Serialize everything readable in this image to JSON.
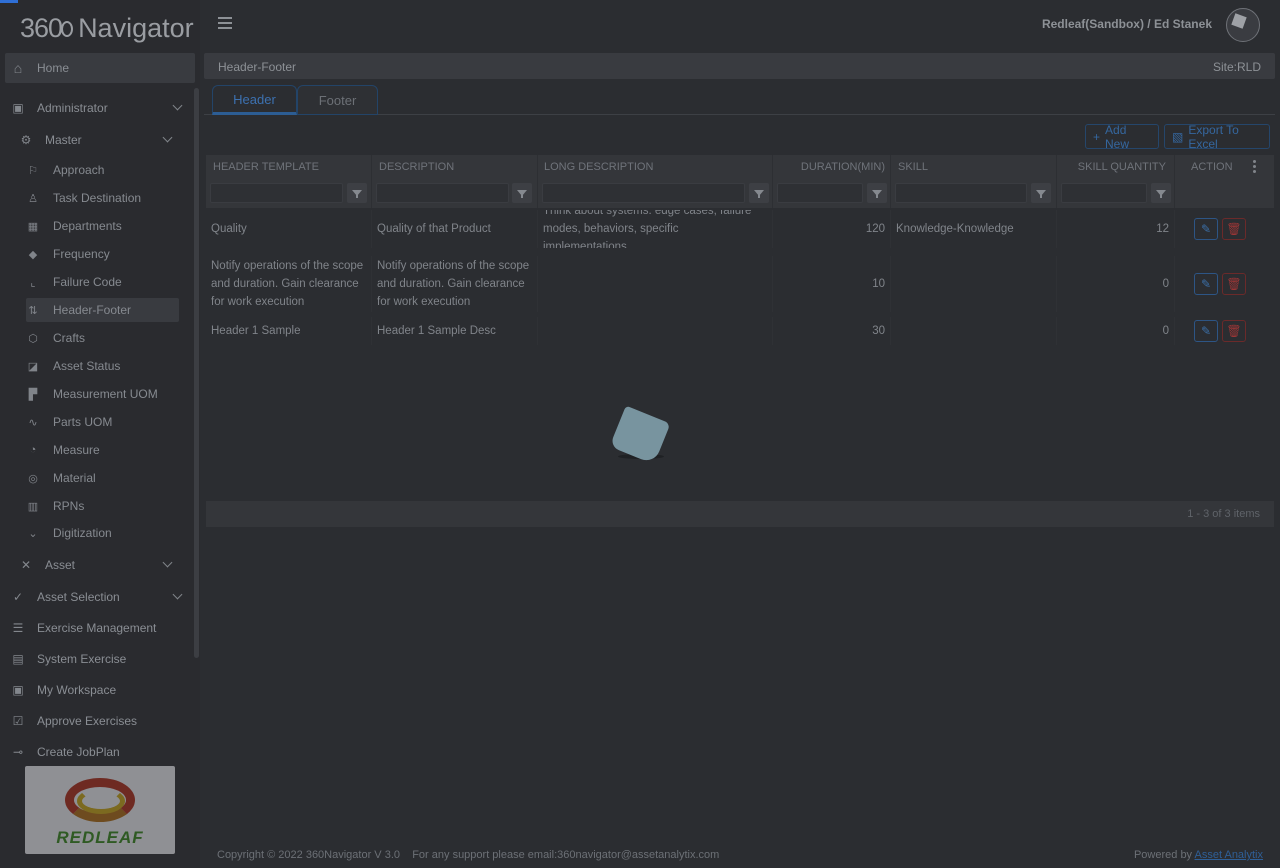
{
  "app": {
    "logo_num": "360",
    "logo_word": "Navigator"
  },
  "header": {
    "user_label": "Redleaf(Sandbox) / Ed Stanek"
  },
  "sidebar": {
    "home": "Home",
    "administrator": "Administrator",
    "master": "Master",
    "sub_items": [
      {
        "label": "Approach",
        "icon": "approach-icon"
      },
      {
        "label": "Task Destination",
        "icon": "person-icon"
      },
      {
        "label": "Departments",
        "icon": "departments-icon"
      },
      {
        "label": "Frequency",
        "icon": "frequency-icon"
      },
      {
        "label": "Failure Code",
        "icon": "chart-icon"
      },
      {
        "label": "Header-Footer",
        "icon": "sort-icon"
      },
      {
        "label": "Crafts",
        "icon": "cube-icon"
      },
      {
        "label": "Asset Status",
        "icon": "tag-icon"
      },
      {
        "label": "Measurement UOM",
        "icon": "ruler-icon"
      },
      {
        "label": "Parts UOM",
        "icon": "pulse-icon"
      },
      {
        "label": "Measure",
        "icon": "gauge-icon"
      },
      {
        "label": "Material",
        "icon": "target-icon"
      },
      {
        "label": "RPNs",
        "icon": "calculator-icon"
      },
      {
        "label": "Digitization",
        "icon": "chevron-down-icon"
      }
    ],
    "asset": "Asset",
    "asset_selection": "Asset Selection",
    "exercise_management": "Exercise Management",
    "system_exercise": "System Exercise",
    "my_workspace": "My Workspace",
    "approve_exercises": "Approve Exercises",
    "create_jobplan": "Create JobPlan",
    "logo_text": "REDLEAF"
  },
  "page": {
    "title": "Header-Footer",
    "site": "Site:RLD"
  },
  "tabs": [
    {
      "label": "Header"
    },
    {
      "label": "Footer"
    }
  ],
  "toolbar": {
    "add_new": "Add New",
    "export": "Export To Excel"
  },
  "grid": {
    "columns": [
      "HEADER TEMPLATE",
      "DESCRIPTION",
      "LONG DESCRIPTION",
      "DURATION(MIN)",
      "SKILL",
      "SKILL QUANTITY",
      "ACTION"
    ],
    "rows": [
      {
        "header_template": "Quality",
        "description": "Quality of that Product",
        "long_description": "Think about systems: edge cases, failure modes, behaviors, specific implementations.",
        "duration": "120",
        "skill": "Knowledge-Knowledge",
        "skill_quantity": "12"
      },
      {
        "header_template": "Notify operations of the scope and duration. Gain clearance for work execution",
        "description": "Notify operations of the scope and duration. Gain clearance for work execution",
        "long_description": "",
        "duration": "10",
        "skill": "",
        "skill_quantity": "0"
      },
      {
        "header_template": "Header 1 Sample",
        "description": "Header 1 Sample Desc",
        "long_description": "",
        "duration": "30",
        "skill": "",
        "skill_quantity": "0"
      }
    ],
    "pager_info": "1 - 3 of 3 items"
  },
  "footer": {
    "copyright": "Copyright © 2022 360Navigator V 3.0    For any support please email:360navigator@assetanalytix.com",
    "powered_by": "Powered by",
    "powered_link": "Asset Analytix"
  }
}
